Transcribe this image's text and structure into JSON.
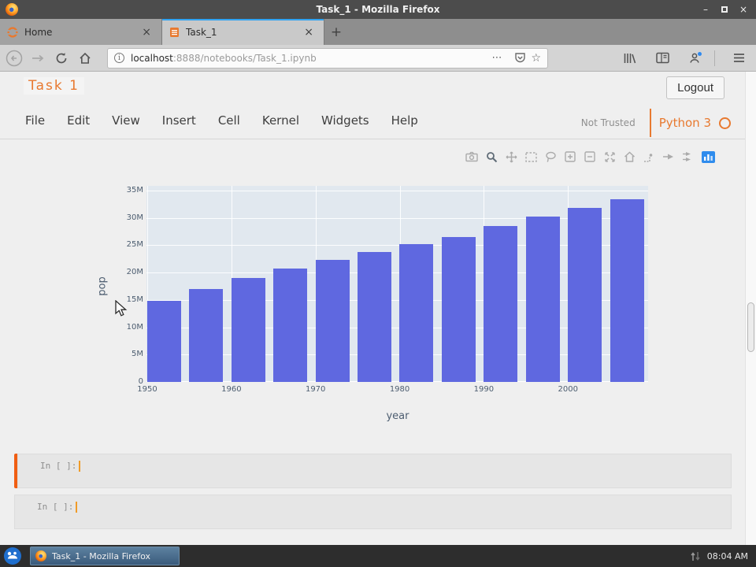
{
  "window": {
    "title": "Task_1 - Mozilla Firefox"
  },
  "browser": {
    "tabs": [
      {
        "label": "Home",
        "active": false
      },
      {
        "label": "Task_1",
        "active": true
      }
    ],
    "new_tab_label": "+",
    "url": {
      "host": "localhost",
      "path": ":8888/notebooks/Task_1.ipynb"
    }
  },
  "jupyter": {
    "title": "Task 1",
    "logout_label": "Logout",
    "menu": [
      "File",
      "Edit",
      "View",
      "Insert",
      "Cell",
      "Kernel",
      "Widgets",
      "Help"
    ],
    "trust_status": "Not Trusted",
    "kernel_name": "Python 3"
  },
  "modebar_icons": [
    "camera-icon",
    "zoom-icon",
    "pan-icon",
    "box-select-icon",
    "lasso-select-icon",
    "zoom-in-icon",
    "zoom-out-icon",
    "autoscale-icon",
    "reset-axes-icon",
    "spikelines-icon",
    "hover-closest-icon",
    "hover-compare-icon",
    "plotly-logo-icon"
  ],
  "chart_data": {
    "type": "bar",
    "xlabel": "year",
    "ylabel": "pop",
    "x": [
      1952,
      1957,
      1962,
      1967,
      1972,
      1977,
      1982,
      1987,
      1992,
      1997,
      2002,
      2007
    ],
    "values": [
      14785584,
      17010154,
      18985849,
      20819767,
      22284500,
      23796400,
      25201900,
      26549700,
      28523502,
      30305843,
      31902268,
      33390141
    ],
    "x_ticks": [
      {
        "value": 1950,
        "label": "1950"
      },
      {
        "value": 1960,
        "label": "1960"
      },
      {
        "value": 1970,
        "label": "1970"
      },
      {
        "value": 1980,
        "label": "1980"
      },
      {
        "value": 1990,
        "label": "1990"
      },
      {
        "value": 2000,
        "label": "2000"
      }
    ],
    "y_ticks": [
      {
        "value": 0,
        "label": "0"
      },
      {
        "value": 5000000,
        "label": "5M"
      },
      {
        "value": 10000000,
        "label": "10M"
      },
      {
        "value": 15000000,
        "label": "15M"
      },
      {
        "value": 20000000,
        "label": "20M"
      },
      {
        "value": 25000000,
        "label": "25M"
      },
      {
        "value": 30000000,
        "label": "30M"
      },
      {
        "value": 35000000,
        "label": "35M"
      }
    ],
    "ylim": [
      0,
      36500000
    ],
    "grid": true,
    "legend_visible": false,
    "bar_color": "#5f68e0",
    "plot_bg": "#e1e8ef"
  },
  "cells": [
    {
      "prompt": "In [ ]:",
      "selected": true
    },
    {
      "prompt": "In [ ]:",
      "selected": false
    }
  ],
  "taskbar": {
    "app_button": "Task_1 - Mozilla Firefox",
    "clock": "08:04 AM"
  },
  "colors": {
    "accent_orange": "#e8792f",
    "tab_active_stripe": "#31a3f2",
    "selected_cell_border": "#f05e12",
    "titlebar": "#4c4c4c",
    "taskbar": "#2d2d2d"
  }
}
